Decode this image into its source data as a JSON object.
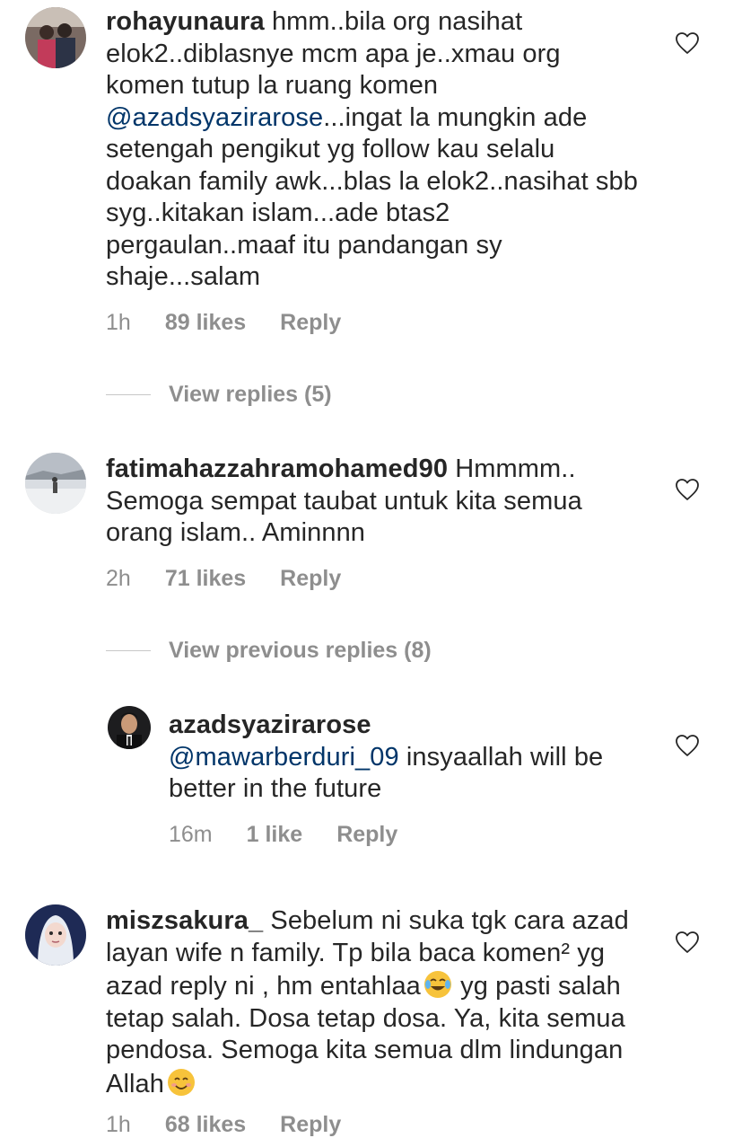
{
  "comments": [
    {
      "username": "rohayunaura",
      "text_before_mention": "hmm..bila org nasihat elok2..diblasnye mcm apa je..xmau org komen tutup la ruang komen ",
      "mention": "@azadsyazirarose",
      "text_after_mention": "...ingat la mungkin ade setengah pengikut yg follow kau selalu doakan family awk...blas la elok2..nasihat sbb syg..kitakan islam...ade btas2 pergaulan..maaf itu pandangan sy shaje...salam",
      "time": "1h",
      "likes": "89 likes",
      "reply_label": "Reply",
      "view_replies": "View replies (5)"
    },
    {
      "username": "fatimahazzahramohamed90",
      "text": "Hmmmm.. Semoga sempat taubat untuk kita semua orang islam.. Aminnnn",
      "time": "2h",
      "likes": "71 likes",
      "reply_label": "Reply",
      "view_replies": "View previous replies (8)"
    },
    {
      "username": "azadsyazirarose",
      "mention": "@mawarberduri_09",
      "text": " insyaallah will be better in the future",
      "time": "16m",
      "likes": "1 like",
      "reply_label": "Reply"
    },
    {
      "username": "miszsakura_",
      "text_part1": "Sebelum ni suka tgk cara azad layan wife n family. Tp bila baca komen² yg azad reply ni , hm entahlaa",
      "text_part2": "yg pasti salah tetap salah. Dosa tetap dosa. Ya, kita semua pendosa. Semoga kita semua dlm lindungan Allah",
      "emoji1": "face-with-tears-of-joy",
      "emoji2": "smiling-face",
      "time": "1h",
      "likes": "68 likes",
      "reply_label": "Reply"
    }
  ],
  "icons": {
    "like": "heart-outline-icon"
  },
  "colors": {
    "text": "#262626",
    "meta": "#8e8e8e",
    "mention": "#003569"
  }
}
